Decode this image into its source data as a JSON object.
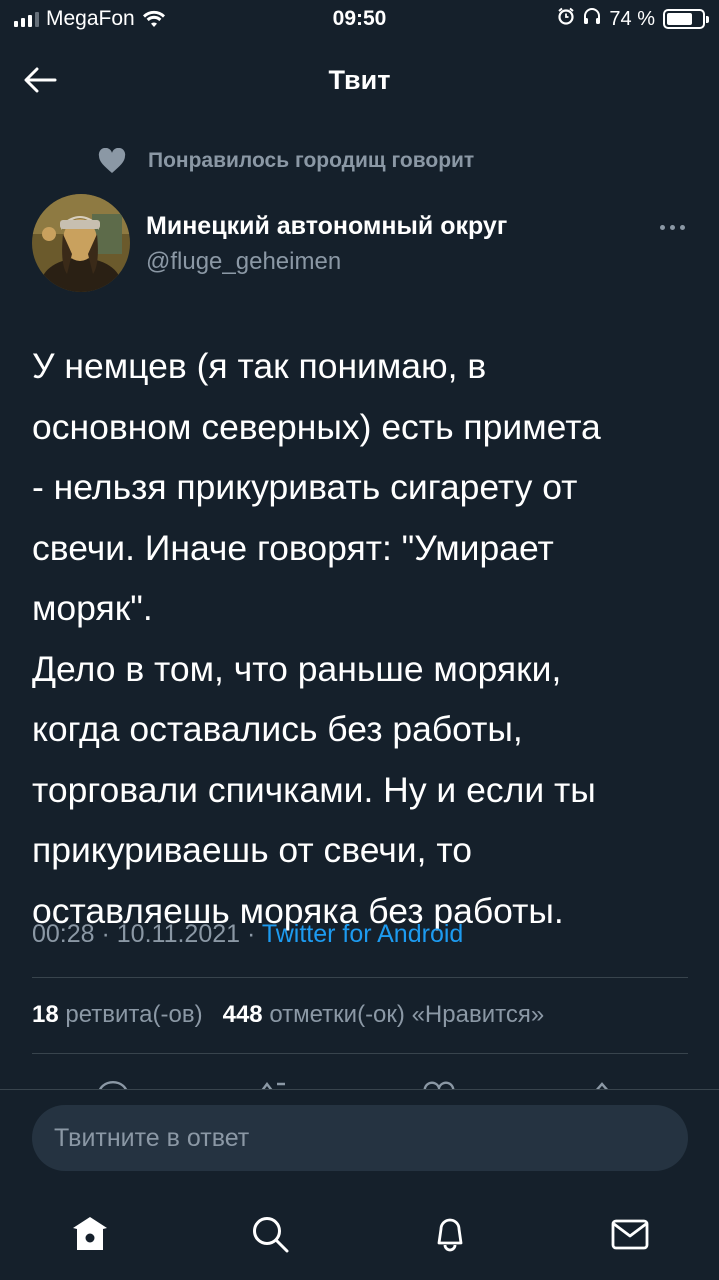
{
  "status_bar": {
    "carrier": "MegaFon",
    "time": "09:50",
    "battery_text": "74 %",
    "battery_level": 0.74
  },
  "header": {
    "title": "Твит"
  },
  "social_context": {
    "text": "Понравилось городищ говорит"
  },
  "author": {
    "name": "Минецкий автономный округ",
    "handle": "@fluge_geheimen"
  },
  "tweet": {
    "lines": [
      "У немцев (я так понимаю, в",
      "основном северных) есть примета",
      "- нельзя прикуривать сигарету от",
      "свечи. Иначе говорят: \"Умирает",
      "моряк\".",
      "Дело в том, что раньше моряки,",
      "когда оставались без работы,",
      "торговали спичками. Ну и если ты",
      "прикуриваешь от свечи, то",
      "оставляешь моряка без работы."
    ],
    "time": "00:28",
    "date": "10.11.2021",
    "separator": " · ",
    "source": "Twitter for Android"
  },
  "stats": {
    "retweets_count": "18",
    "retweets_label": "ретвита(-ов)",
    "likes_count": "448",
    "likes_label": "отметки(-ок) «Нравится»"
  },
  "reply": {
    "placeholder": "Твитните в ответ"
  },
  "icons": {
    "back": "arrow-left-icon",
    "heart": "heart-icon",
    "more": "more-horizontal-icon",
    "home": "home-icon",
    "search": "search-icon",
    "notifications": "bell-icon",
    "messages": "envelope-icon"
  },
  "colors": {
    "background": "#15202b",
    "secondary_text": "#8b98a5",
    "link": "#1d9bf0",
    "divider": "#38444d",
    "input_bg": "#253341"
  }
}
